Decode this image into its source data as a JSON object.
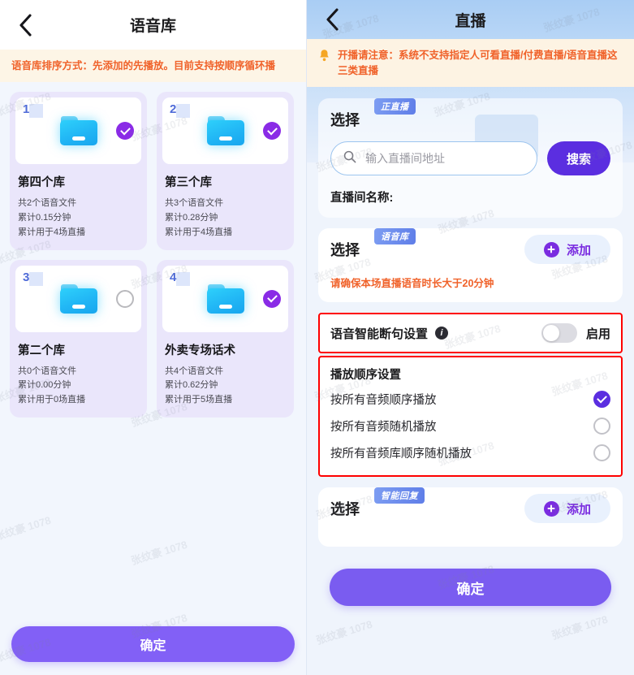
{
  "watermark": "张纹豪 1078",
  "left": {
    "back_icon": "chevron-left-icon",
    "title": "语音库",
    "notice": "语音库排序方式：先添加的先播放。目前支持按顺序循环播",
    "cards": [
      {
        "num": "1",
        "name": "第四个库",
        "files": "共2个语音文件",
        "duration": "累计0.15分钟",
        "usage": "累计用于4场直播",
        "selected": true
      },
      {
        "num": "2",
        "name": "第三个库",
        "files": "共3个语音文件",
        "duration": "累计0.28分钟",
        "usage": "累计用于4场直播",
        "selected": true
      },
      {
        "num": "3",
        "name": "第二个库",
        "files": "共0个语音文件",
        "duration": "累计0.00分钟",
        "usage": "累计用于0场直播",
        "selected": false
      },
      {
        "num": "4",
        "name": "外卖专场话术",
        "files": "共4个语音文件",
        "duration": "累计0.62分钟",
        "usage": "累计用于5场直播",
        "selected": true
      }
    ],
    "confirm_label": "确定"
  },
  "right": {
    "back_icon": "chevron-left-icon",
    "title": "直播",
    "notice": "开播请注意：系统不支持指定人可看直播/付费直播/语音直播这三类直播",
    "live_section": {
      "select_label": "选择",
      "badge": "正直播",
      "search_placeholder": "输入直播间地址",
      "search_value": "",
      "search_button": "搜索",
      "room_name_label": "直播间名称:"
    },
    "voice_section": {
      "select_label": "选择",
      "badge": "语音库",
      "add_label": "添加",
      "warning": "请确保本场直播语音时长大于20分钟"
    },
    "smart_break": {
      "label": "语音智能断句设置",
      "info_icon": "info-icon",
      "toggle_on": false,
      "toggle_label": "启用"
    },
    "play_order": {
      "title": "播放顺序设置",
      "options": [
        {
          "label": "按所有音频顺序播放",
          "selected": true
        },
        {
          "label": "按所有音频随机播放",
          "selected": false
        },
        {
          "label": "按所有音频库顺序随机播放",
          "selected": false
        }
      ]
    },
    "reply_section": {
      "select_label": "选择",
      "badge": "智能回复",
      "add_label": "添加"
    },
    "confirm_label": "确定"
  },
  "colors": {
    "accent_purple": "#7a5cf0",
    "deep_purple": "#5b2ee0",
    "warn_orange": "#f0622a",
    "highlight_red": "#ff0000",
    "folder_blue": "#2ec8fb"
  }
}
